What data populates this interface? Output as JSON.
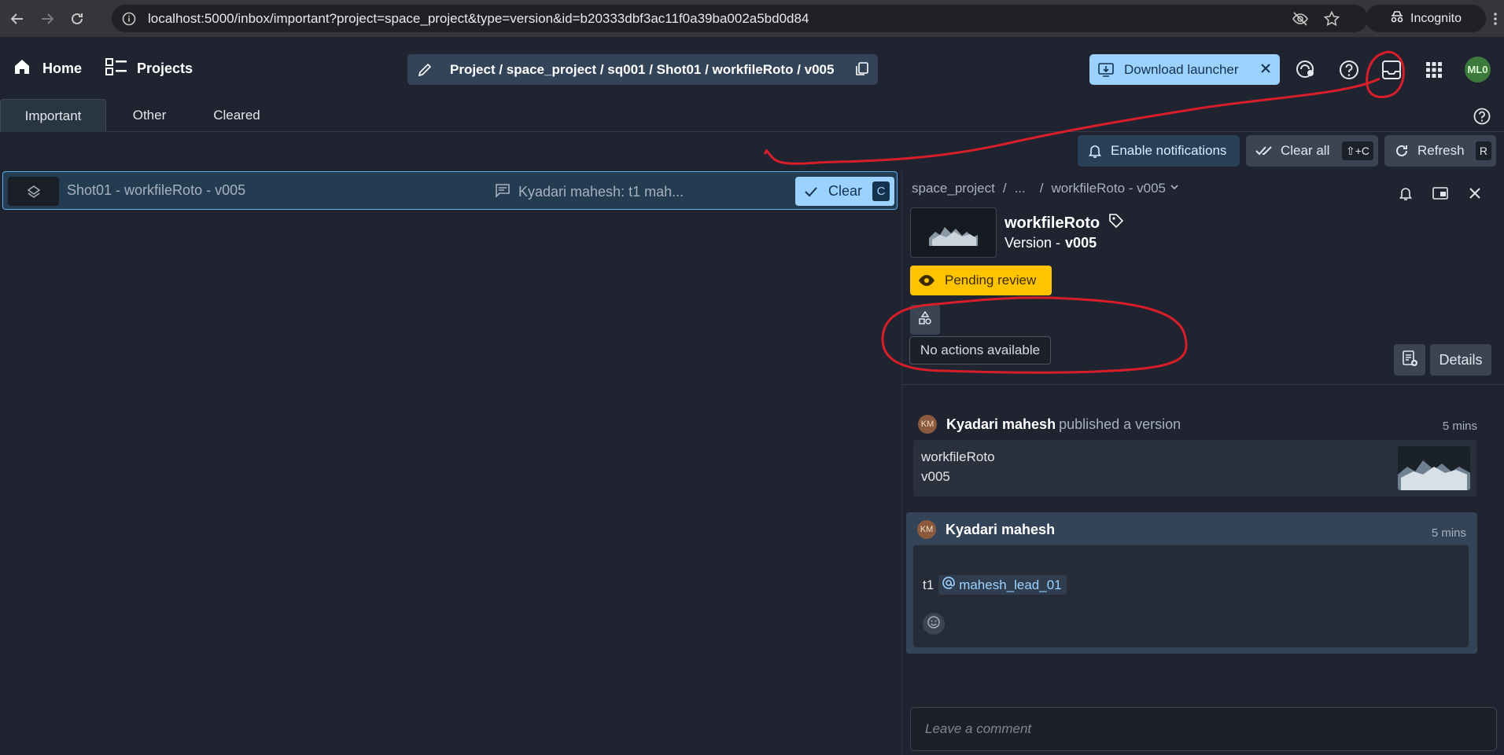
{
  "browser": {
    "url": "localhost:5000/inbox/important?project=space_project&type=version&id=b20333dbf3ac11f0a39ba002a5bd0d84",
    "incognito_label": "Incognito"
  },
  "header": {
    "home_label": "Home",
    "projects_label": "Projects",
    "breadcrumb": "Project / space_project / sq001 / Shot01 / workfileRoto / v005",
    "download_label": "Download launcher",
    "user_initials": "ML0"
  },
  "tabs": [
    {
      "label": "Important",
      "active": true
    },
    {
      "label": "Other",
      "active": false
    },
    {
      "label": "Cleared",
      "active": false
    }
  ],
  "toolbar": {
    "notifications_label": "Enable notifications",
    "clear_all_label": "Clear all",
    "clear_all_shortcut": "⇧+C",
    "refresh_label": "Refresh",
    "refresh_shortcut": "R"
  },
  "inbox": {
    "rows": [
      {
        "title": "Shot01 - workfileRoto - v005",
        "message": "Kyadari mahesh: t1 mah...",
        "clear_label": "Clear",
        "clear_shortcut": "C"
      }
    ]
  },
  "panel": {
    "crumb_project": "space_project",
    "crumb_sep1": "/",
    "crumb_ellipsis": "...",
    "crumb_sep2": "/",
    "crumb_current": "workfileRoto - v005",
    "title": "workfileRoto",
    "subtitle_prefix": "Version -",
    "subtitle_version": "v005",
    "status": "Pending review",
    "tooltip": "No actions available",
    "details_label": "Details",
    "comment_placeholder": "Leave a comment"
  },
  "feed": [
    {
      "initials": "KM",
      "author": "Kyadari mahesh",
      "verb": "published a version",
      "time": "5 mins",
      "card_name": "workfileRoto",
      "card_version": "v005"
    },
    {
      "initials": "KM",
      "author": "Kyadari mahesh",
      "time": "5 mins",
      "text": "t1",
      "mention": "mahesh_lead_01"
    }
  ],
  "colors": {
    "accent": "#9cd2ff",
    "status_pending": "#ffc400",
    "annotation": "#d81e2a"
  }
}
